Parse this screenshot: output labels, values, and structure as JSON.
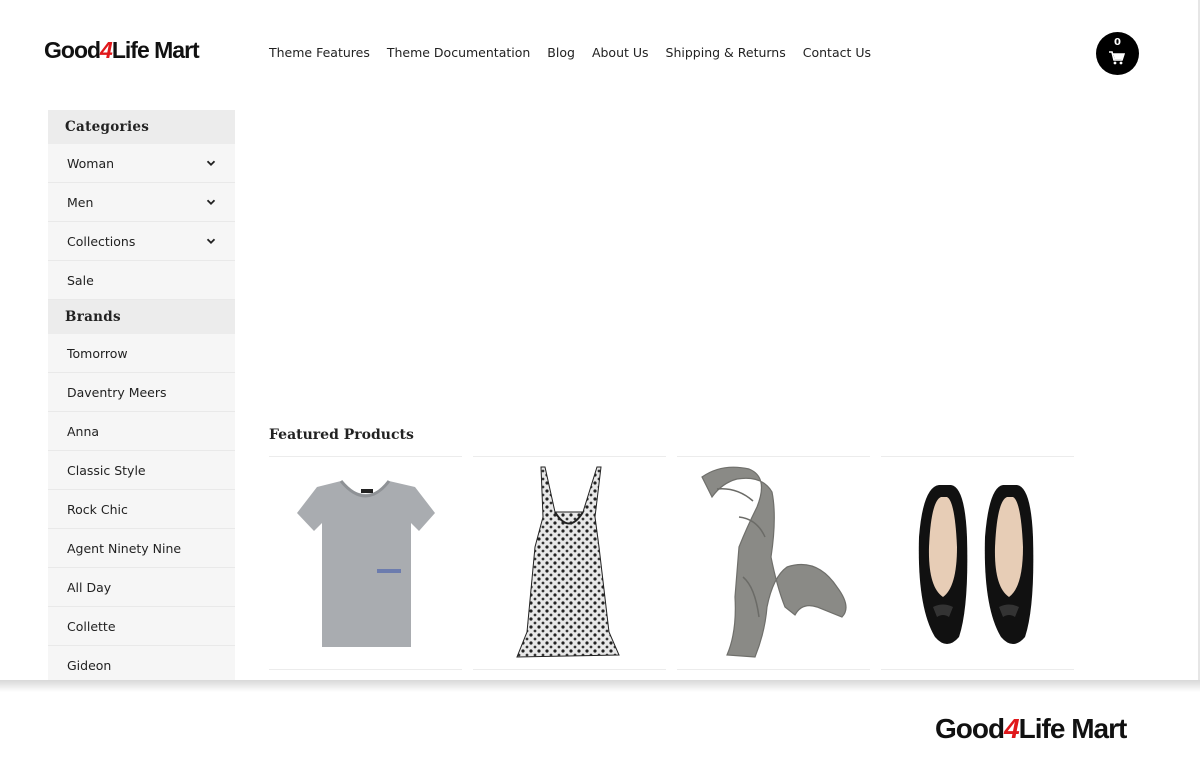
{
  "brand": {
    "logo_main": "Good",
    "logo_num": "4",
    "logo_rest": "Life Mart"
  },
  "nav": [
    {
      "label": "Theme Features"
    },
    {
      "label": "Theme Documentation"
    },
    {
      "label": "Blog"
    },
    {
      "label": "About Us"
    },
    {
      "label": "Shipping & Returns"
    },
    {
      "label": "Contact Us"
    }
  ],
  "cart": {
    "count": "0"
  },
  "sidebar": {
    "categories_title": "Categories",
    "categories": [
      {
        "label": "Woman",
        "expandable": true
      },
      {
        "label": "Men",
        "expandable": true
      },
      {
        "label": "Collections",
        "expandable": true
      },
      {
        "label": "Sale",
        "expandable": false
      }
    ],
    "brands_title": "Brands",
    "brands": [
      {
        "label": "Tomorrow"
      },
      {
        "label": "Daventry Meers"
      },
      {
        "label": "Anna"
      },
      {
        "label": "Classic Style"
      },
      {
        "label": "Rock Chic"
      },
      {
        "label": "Agent Ninety Nine"
      },
      {
        "label": "All Day"
      },
      {
        "label": "Collette"
      },
      {
        "label": "Gideon"
      }
    ]
  },
  "featured": {
    "title": "Featured Products",
    "products": [
      {
        "image": "grey-tshirt"
      },
      {
        "image": "black-print-dress"
      },
      {
        "image": "grey-scarf"
      },
      {
        "image": "black-ballet-flats"
      }
    ]
  },
  "colors": {
    "accent": "#e0181b",
    "sidebar_head": "#ececec",
    "sidebar_item": "#f6f6f6",
    "cart": "#000000"
  }
}
